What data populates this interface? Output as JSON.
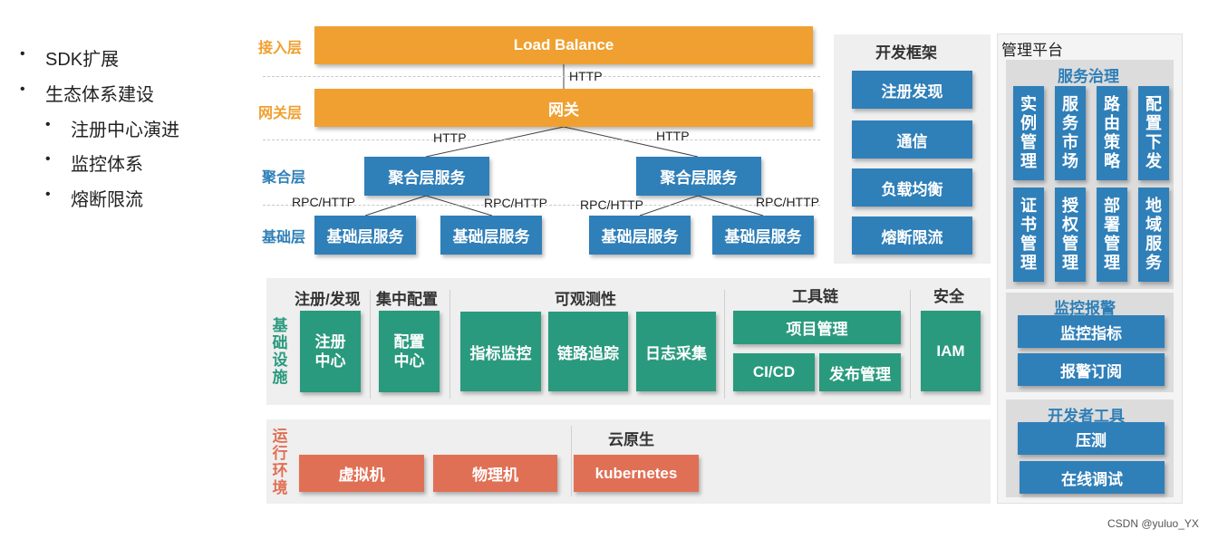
{
  "bullets": {
    "sdk": "SDK扩展",
    "eco": "生态体系建设",
    "sub1": "注册中心演进",
    "sub2": "监控体系",
    "sub3": "熔断限流"
  },
  "layers": {
    "access": "接入层",
    "gateway": "网关层",
    "aggregate": "聚合层",
    "base": "基础层"
  },
  "boxes": {
    "load_balance": "Load Balance",
    "gateway": "网关",
    "agg_left": "聚合层服务",
    "agg_right": "聚合层服务",
    "base1": "基础层服务",
    "base2": "基础层服务",
    "base3": "基础层服务",
    "base4": "基础层服务"
  },
  "connections": {
    "http_lb": "HTTP",
    "http_left": "HTTP",
    "http_right": "HTTP",
    "rpc1": "RPC/HTTP",
    "rpc2": "RPC/HTTP",
    "rpc3": "RPC/HTTP",
    "rpc4": "RPC/HTTP"
  },
  "dev_framework": {
    "title": "开发框架",
    "items": [
      "注册发现",
      "通信",
      "负载均衡",
      "熔断限流"
    ]
  },
  "infra": {
    "label": "基础设施",
    "sections": {
      "reg": "注册/发现",
      "config": "集中配置",
      "observe": "可观测性",
      "tools": "工具链",
      "security": "安全"
    },
    "boxes": {
      "reg_center": "注册中心",
      "config_center": "配置中心",
      "metrics": "指标监控",
      "tracing": "链路追踪",
      "logging": "日志采集",
      "project": "项目管理",
      "cicd": "CI/CD",
      "release": "发布管理",
      "iam": "IAM"
    }
  },
  "runtime": {
    "label": "运行环境",
    "cloud_title": "云原生",
    "vm": "虚拟机",
    "physical": "物理机",
    "k8s": "kubernetes"
  },
  "mgmt": {
    "title": "管理平台",
    "governance": {
      "title": "服务治理",
      "items": [
        "实例管理",
        "服务市场",
        "路由策略",
        "配置下发",
        "证书管理",
        "授权管理",
        "部署管理",
        "地域服务"
      ]
    },
    "monitoring": {
      "title": "监控报警",
      "items": [
        "监控指标",
        "报警订阅"
      ]
    },
    "devtools": {
      "title": "开发者工具",
      "items": [
        "压测",
        "在线调试"
      ]
    }
  },
  "footer": "CSDN @yuluo_YX",
  "colors": {
    "orange": "#f0a030",
    "blue": "#2f7fb9",
    "green": "#2a9a7e",
    "red": "#e07055"
  }
}
